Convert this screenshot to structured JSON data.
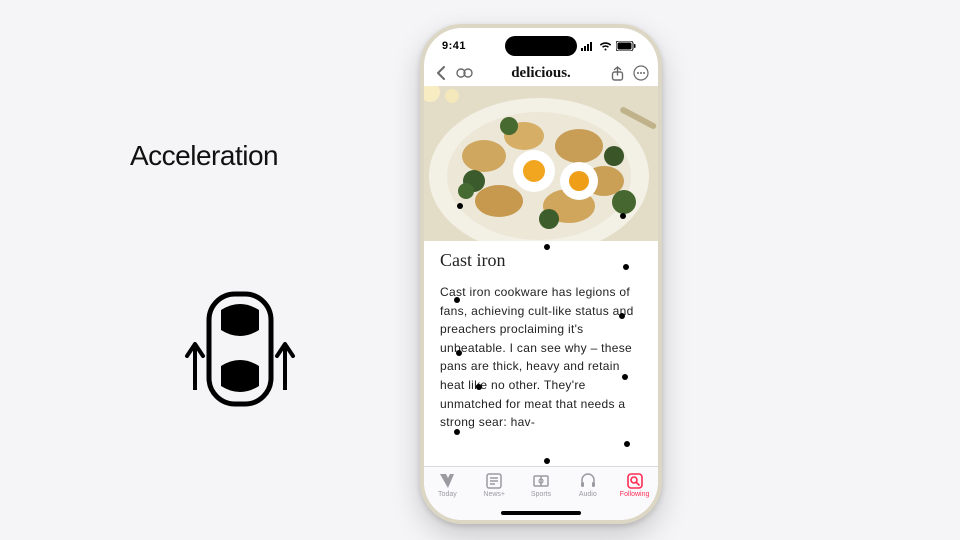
{
  "left": {
    "headline": "Acceleration",
    "car_icon": "car-outline"
  },
  "phone": {
    "status": {
      "time": "9:41"
    },
    "nav": {
      "back": "chevron-left",
      "title": "delicious.",
      "share": "share-icon",
      "more": "ellipsis-icon",
      "secondary": "grouped-pages-icon"
    },
    "article": {
      "heading": "Cast iron",
      "body": "Cast iron cookware has legions of fans, achieving cult-like status and preachers proclaiming it's unbeatable. I can see why – these pans are thick, heavy and retain heat like no other. They're unmatched for meat that needs a strong sear: hav-"
    },
    "tabs": [
      {
        "label": "Today",
        "active": false
      },
      {
        "label": "News+",
        "active": false
      },
      {
        "label": "Sports",
        "active": false
      },
      {
        "label": "Audio",
        "active": false
      },
      {
        "label": "Following",
        "active": true
      }
    ]
  }
}
